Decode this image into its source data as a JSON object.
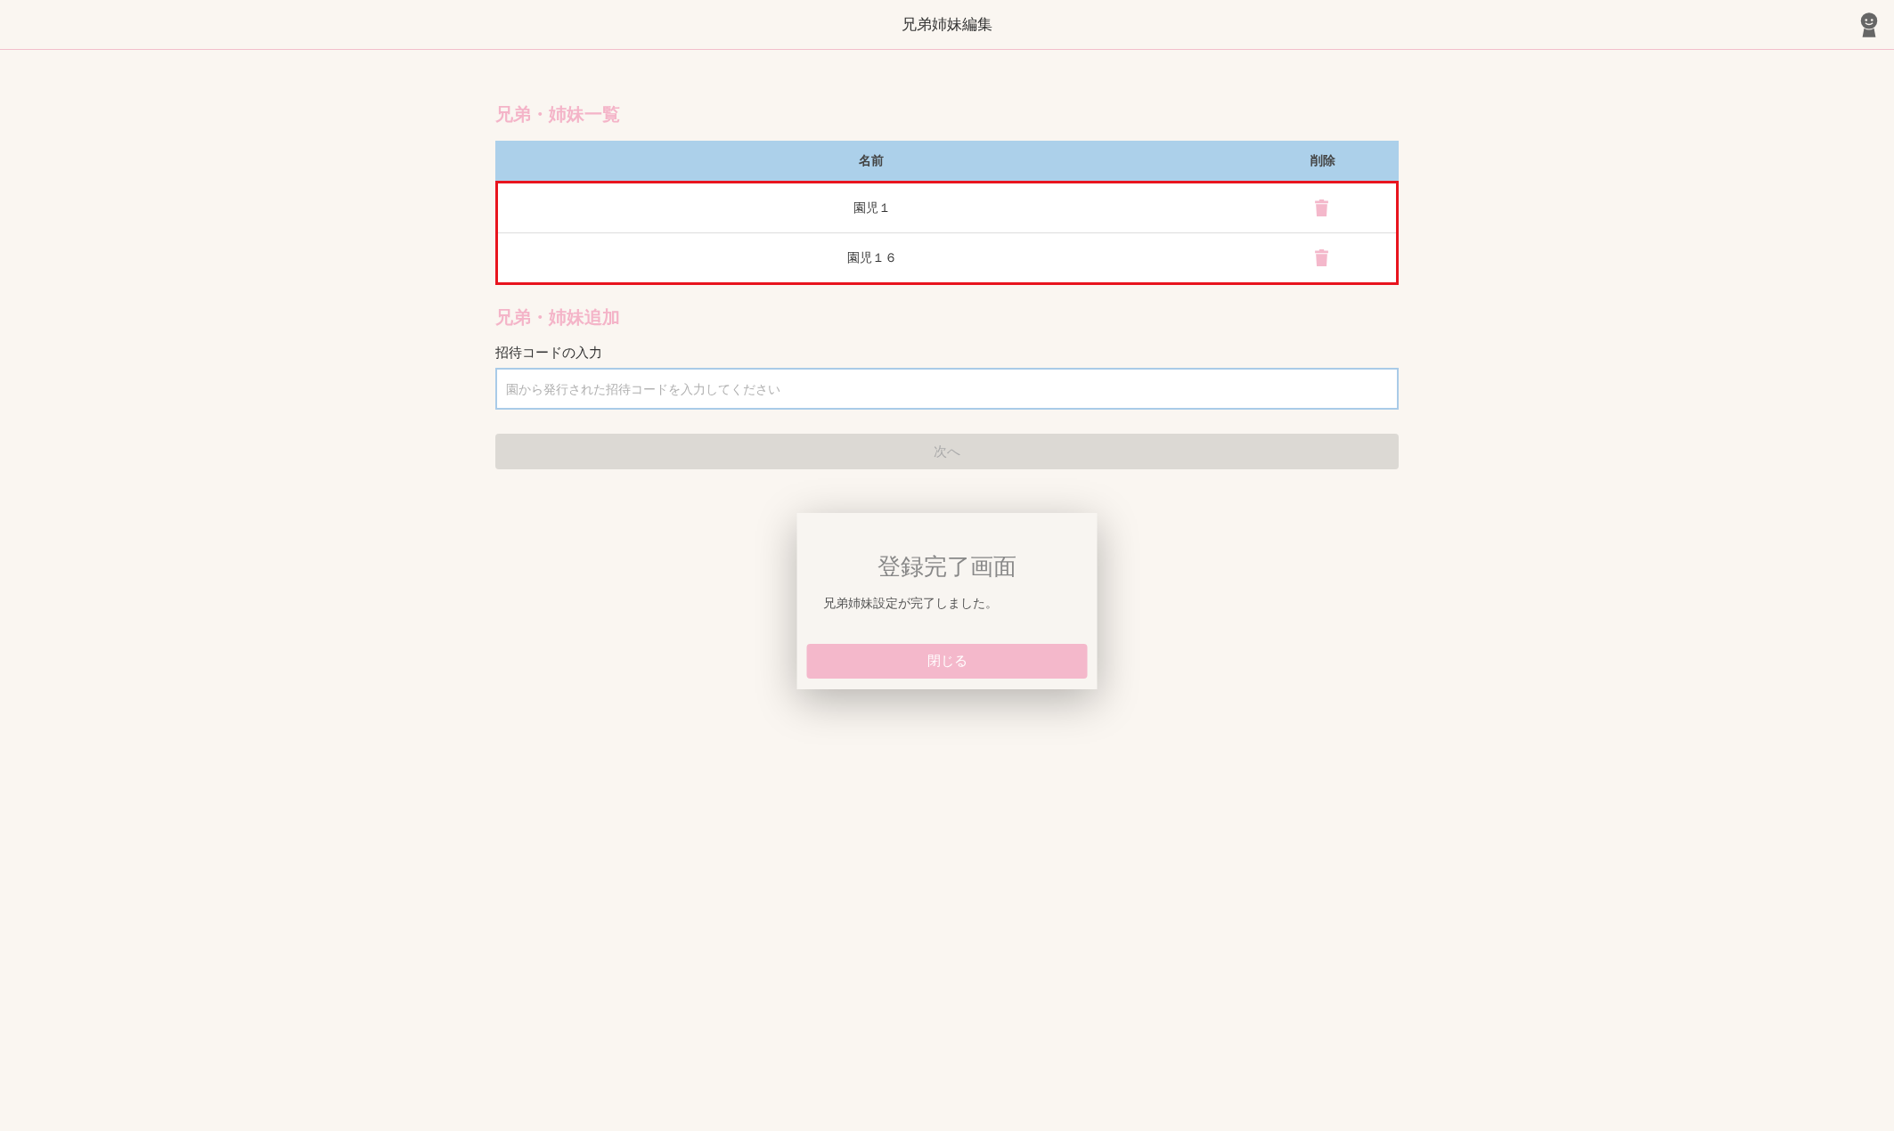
{
  "header": {
    "title": "兄弟姉妹編集"
  },
  "sibling_list": {
    "title": "兄弟・姉妹一覧",
    "highlighted": true,
    "columns": [
      "名前",
      "削除"
    ],
    "rows": [
      {
        "name": "園児１"
      },
      {
        "name": "園児１６"
      }
    ]
  },
  "add_sibling": {
    "title": "兄弟・姉妹追加",
    "label": "招待コードの入力",
    "input": {
      "placeholder": "園から発行された招待コードを入力してください"
    },
    "next_button": {
      "label": "次へ",
      "disabled": true
    }
  },
  "dialog": {
    "title": "登録完了画面",
    "message": "兄弟姉妹設定が完了しました。",
    "close_button": "閉じる"
  }
}
